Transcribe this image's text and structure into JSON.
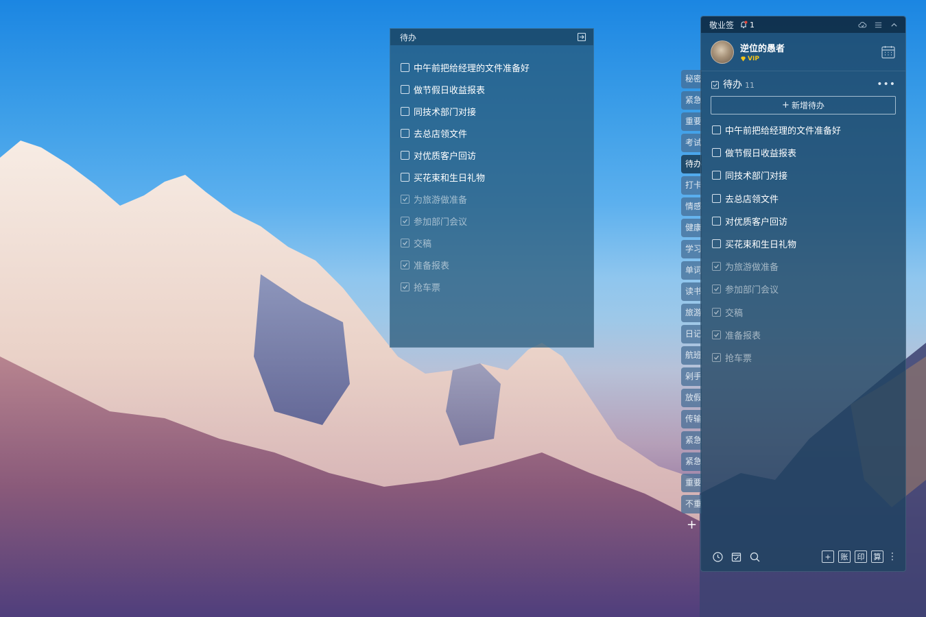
{
  "note": {
    "title": "待办",
    "items": [
      {
        "text": "中午前把给经理的文件准备好",
        "done": false
      },
      {
        "text": "做节假日收益报表",
        "done": false
      },
      {
        "text": "同技术部门对接",
        "done": false
      },
      {
        "text": "去总店领文件",
        "done": false
      },
      {
        "text": "对优质客户回访",
        "done": false
      },
      {
        "text": "买花束和生日礼物",
        "done": false
      },
      {
        "text": "为旅游做准备",
        "done": true
      },
      {
        "text": "参加部门会议",
        "done": true
      },
      {
        "text": "交稿",
        "done": true
      },
      {
        "text": "准备报表",
        "done": true
      },
      {
        "text": "抢车票",
        "done": true
      }
    ]
  },
  "tabs": [
    "秘密",
    "紧急",
    "重要",
    "考试",
    "待办",
    "打卡",
    "情感",
    "健康",
    "学习",
    "单词",
    "读书",
    "旅游",
    "日记",
    "航班",
    "剁手",
    "放假",
    "传输",
    "紧急",
    "紧急",
    "重要",
    "不重"
  ],
  "active_tab": "待办",
  "tab_add_label": "+",
  "panel": {
    "app_title": "敬业签",
    "notification_count": "1",
    "username": "逆位的愚者",
    "vip_label": "VIP",
    "section_title": "待办",
    "section_count": "11",
    "more_label": "•••",
    "add_label": "新增待办",
    "add_plus": "+",
    "items": [
      {
        "text": "中午前把给经理的文件准备好",
        "done": false
      },
      {
        "text": "做节假日收益报表",
        "done": false
      },
      {
        "text": "同技术部门对接",
        "done": false
      },
      {
        "text": "去总店领文件",
        "done": false
      },
      {
        "text": "对优质客户回访",
        "done": false
      },
      {
        "text": "买花束和生日礼物",
        "done": false
      },
      {
        "text": "为旅游做准备",
        "done": true
      },
      {
        "text": "参加部门会议",
        "done": true
      },
      {
        "text": "交稿",
        "done": true
      },
      {
        "text": "准备报表",
        "done": true
      },
      {
        "text": "抢车票",
        "done": true
      }
    ],
    "bottom_boxes": [
      "+",
      "账",
      "印",
      "算"
    ],
    "bottom_dots": "⋮"
  },
  "icons": {
    "note_exit": "exit-icon",
    "bell": "bell-icon",
    "cloud": "cloud-icon",
    "menu": "menu-icon",
    "collapse": "chevron-up-icon",
    "calendar": "calendar-icon",
    "section": "checklist-icon",
    "clock": "clock-icon",
    "todo": "todo-icon",
    "search": "search-icon"
  }
}
